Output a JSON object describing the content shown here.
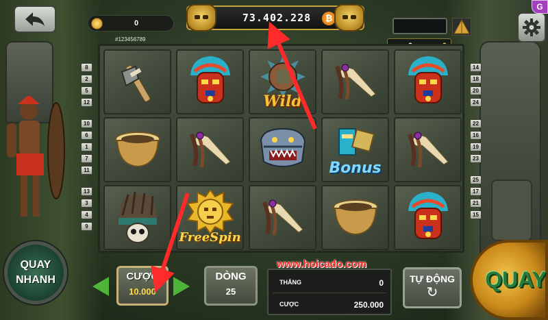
{
  "header": {
    "balance": "0",
    "user_id": "#123456789",
    "jackpot": "73.402.228",
    "bonus_mult_value": "0",
    "bonus_mult_x": "x0",
    "badge": "G"
  },
  "reels": [
    [
      "axe",
      "tribal-mask",
      "pot",
      "dagger",
      "tribal-mask"
    ],
    [
      "wild",
      "dagger",
      "bowl",
      "bonus",
      "dagger"
    ],
    [
      "pot",
      "dagger",
      "jaguar",
      "dagger",
      "dagger"
    ],
    [
      "pot",
      "feather-skull",
      "free-spin",
      "dagger",
      "tribal-mask"
    ]
  ],
  "symbols": {
    "wild": "Wild",
    "bonus": "Bonus",
    "free_spin": "FreeSpin"
  },
  "paylines_left": [
    "8",
    "2",
    "5",
    "12",
    "10",
    "6",
    "1",
    "7",
    "11",
    "13",
    "3",
    "4",
    "9"
  ],
  "paylines_right": [
    "14",
    "18",
    "20",
    "24",
    "22",
    "16",
    "19",
    "23",
    "25",
    "17",
    "21",
    "15"
  ],
  "controls": {
    "quick_line1": "QUAY",
    "quick_line2": "NHANH",
    "bet_label": "CƯỢC",
    "bet_value": "10.000",
    "lines_label": "DÒNG",
    "lines_value": "25",
    "win_label": "THẮNG",
    "win_value": "0",
    "total_bet_label": "CƯỢC",
    "total_bet_value": "250.000",
    "auto_label": "TỰ ĐỘNG",
    "spin_label": "QUAY"
  },
  "watermark": "www.hoicado.com",
  "colors": {
    "accent_gold": "#c8a23a",
    "arrow_red": "#ff2a2a",
    "bet_value": "#ffd84a",
    "nav_green": "#4fb53a"
  },
  "icons": [
    "back-arrow-icon",
    "gear-icon",
    "coin-icon",
    "bitcoin-icon",
    "pyramid-icon",
    "refresh-icon"
  ]
}
